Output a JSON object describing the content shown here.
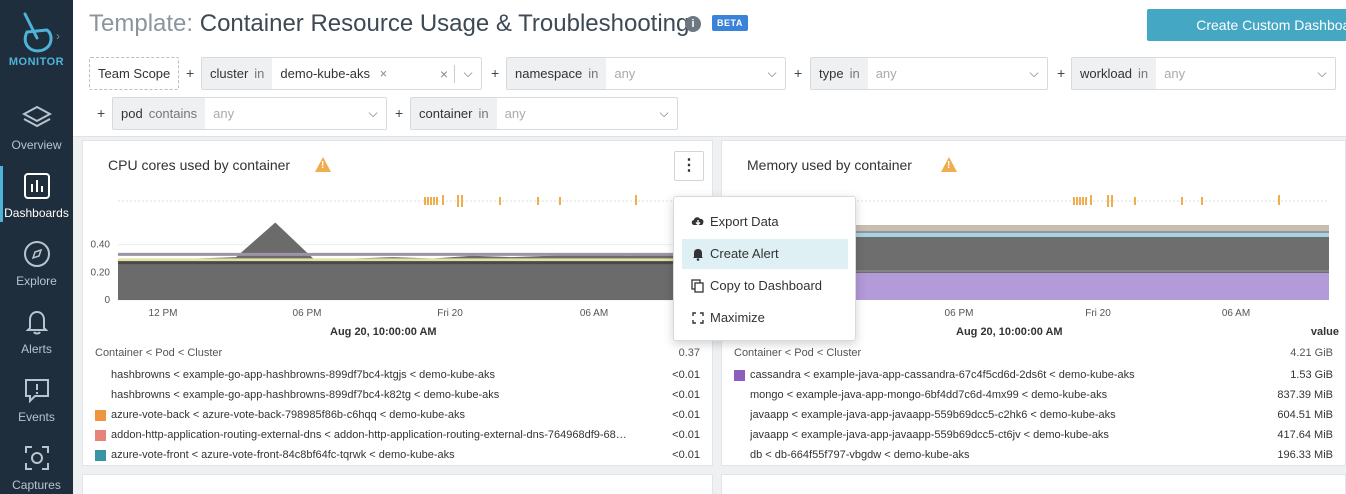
{
  "sidebar": {
    "brand": "MONITOR",
    "items": [
      {
        "label": "Overview"
      },
      {
        "label": "Dashboards"
      },
      {
        "label": "Explore"
      },
      {
        "label": "Alerts"
      },
      {
        "label": "Events"
      },
      {
        "label": "Captures"
      }
    ]
  },
  "header": {
    "title_prefix": "Template:",
    "title": "Container Resource Usage & Troubleshooting",
    "info": "i",
    "badge": "BETA",
    "create_button": "Create Custom Dashboard"
  },
  "filters": {
    "scope_button": "Team Scope",
    "plus": "+",
    "clear": "×",
    "cluster": {
      "label": "cluster",
      "op": "in",
      "value": "demo-kube-aks"
    },
    "namespace": {
      "label": "namespace",
      "op": "in",
      "value": "any"
    },
    "type": {
      "label": "type",
      "op": "in",
      "value": "any"
    },
    "workload": {
      "label": "workload",
      "op": "in",
      "value": "any"
    },
    "pod": {
      "label": "pod",
      "op": "contains",
      "value": "any"
    },
    "container": {
      "label": "container",
      "op": "in",
      "value": "any"
    }
  },
  "cpu_panel": {
    "title": "CPU cores used by container",
    "menu_glyph": "⋮",
    "timestamp": "Aug 20, 10:00:00 AM",
    "legend_header": "Container < Pod < Cluster",
    "legend_total": "0.37",
    "rows": [
      {
        "label": "hashbrowns < example-go-app-hashbrowns-899df7bc4-ktgjs < demo-kube-aks",
        "value": "<0.01",
        "color": ""
      },
      {
        "label": "hashbrowns < example-go-app-hashbrowns-899df7bc4-k82tg < demo-kube-aks",
        "value": "<0.01",
        "color": ""
      },
      {
        "label": "azure-vote-back < azure-vote-back-798985f86b-c6hqq < demo-kube-aks",
        "value": "<0.01",
        "color": "#f0953c"
      },
      {
        "label": "addon-http-application-routing-external-dns < addon-http-application-routing-external-dns-764968df9-68hgp < de...",
        "value": "<0.01",
        "color": "#e8837a"
      },
      {
        "label": "azure-vote-front < azure-vote-front-84c8bf64fc-tqrwk < demo-kube-aks",
        "value": "<0.01",
        "color": "#3b93a6"
      }
    ]
  },
  "mem_panel": {
    "title": "Memory used by container",
    "timestamp": "Aug 20, 10:00:00 AM",
    "value_header": "value",
    "legend_header": "Container < Pod < Cluster",
    "legend_total": "4.21 GiB",
    "rows": [
      {
        "label": "cassandra < example-java-app-cassandra-67c4f5cd6d-2ds6t < demo-kube-aks",
        "value": "1.53 GiB",
        "color": "#8c5fbf"
      },
      {
        "label": "mongo < example-java-app-mongo-6bf4dd7c6d-4mx99 < demo-kube-aks",
        "value": "837.39 MiB",
        "color": ""
      },
      {
        "label": "javaapp < example-java-app-javaapp-559b69dcc5-c2hk6 < demo-kube-aks",
        "value": "604.51 MiB",
        "color": ""
      },
      {
        "label": "javaapp < example-java-app-javaapp-559b69dcc5-ct6jv < demo-kube-aks",
        "value": "417.64 MiB",
        "color": ""
      },
      {
        "label": "db < db-664f55f797-vbgdw < demo-kube-aks",
        "value": "196.33 MiB",
        "color": ""
      }
    ]
  },
  "menu": {
    "items": [
      {
        "label": "Export Data"
      },
      {
        "label": "Create Alert"
      },
      {
        "label": "Copy to Dashboard"
      },
      {
        "label": "Maximize"
      }
    ]
  },
  "chart_data": [
    {
      "type": "area",
      "title": "CPU cores used by container",
      "x_ticks": [
        "12 PM",
        "06 PM",
        "Fri 20",
        "06 AM"
      ],
      "y_ticks": [
        "0",
        "0.20",
        "0.40"
      ],
      "ylim": [
        0,
        0.6
      ],
      "series": [
        {
          "values": [
            0.3,
            0.29,
            0.3,
            0.31,
            0.56,
            0.29,
            0.3,
            0.31,
            0.3,
            0.32,
            0.31,
            0.32,
            0.33,
            0.32,
            0.33,
            0.33
          ]
        }
      ]
    },
    {
      "type": "area",
      "title": "Memory used by container",
      "x_ticks": [
        "06 PM",
        "Fri 20",
        "06 AM"
      ]
    }
  ]
}
